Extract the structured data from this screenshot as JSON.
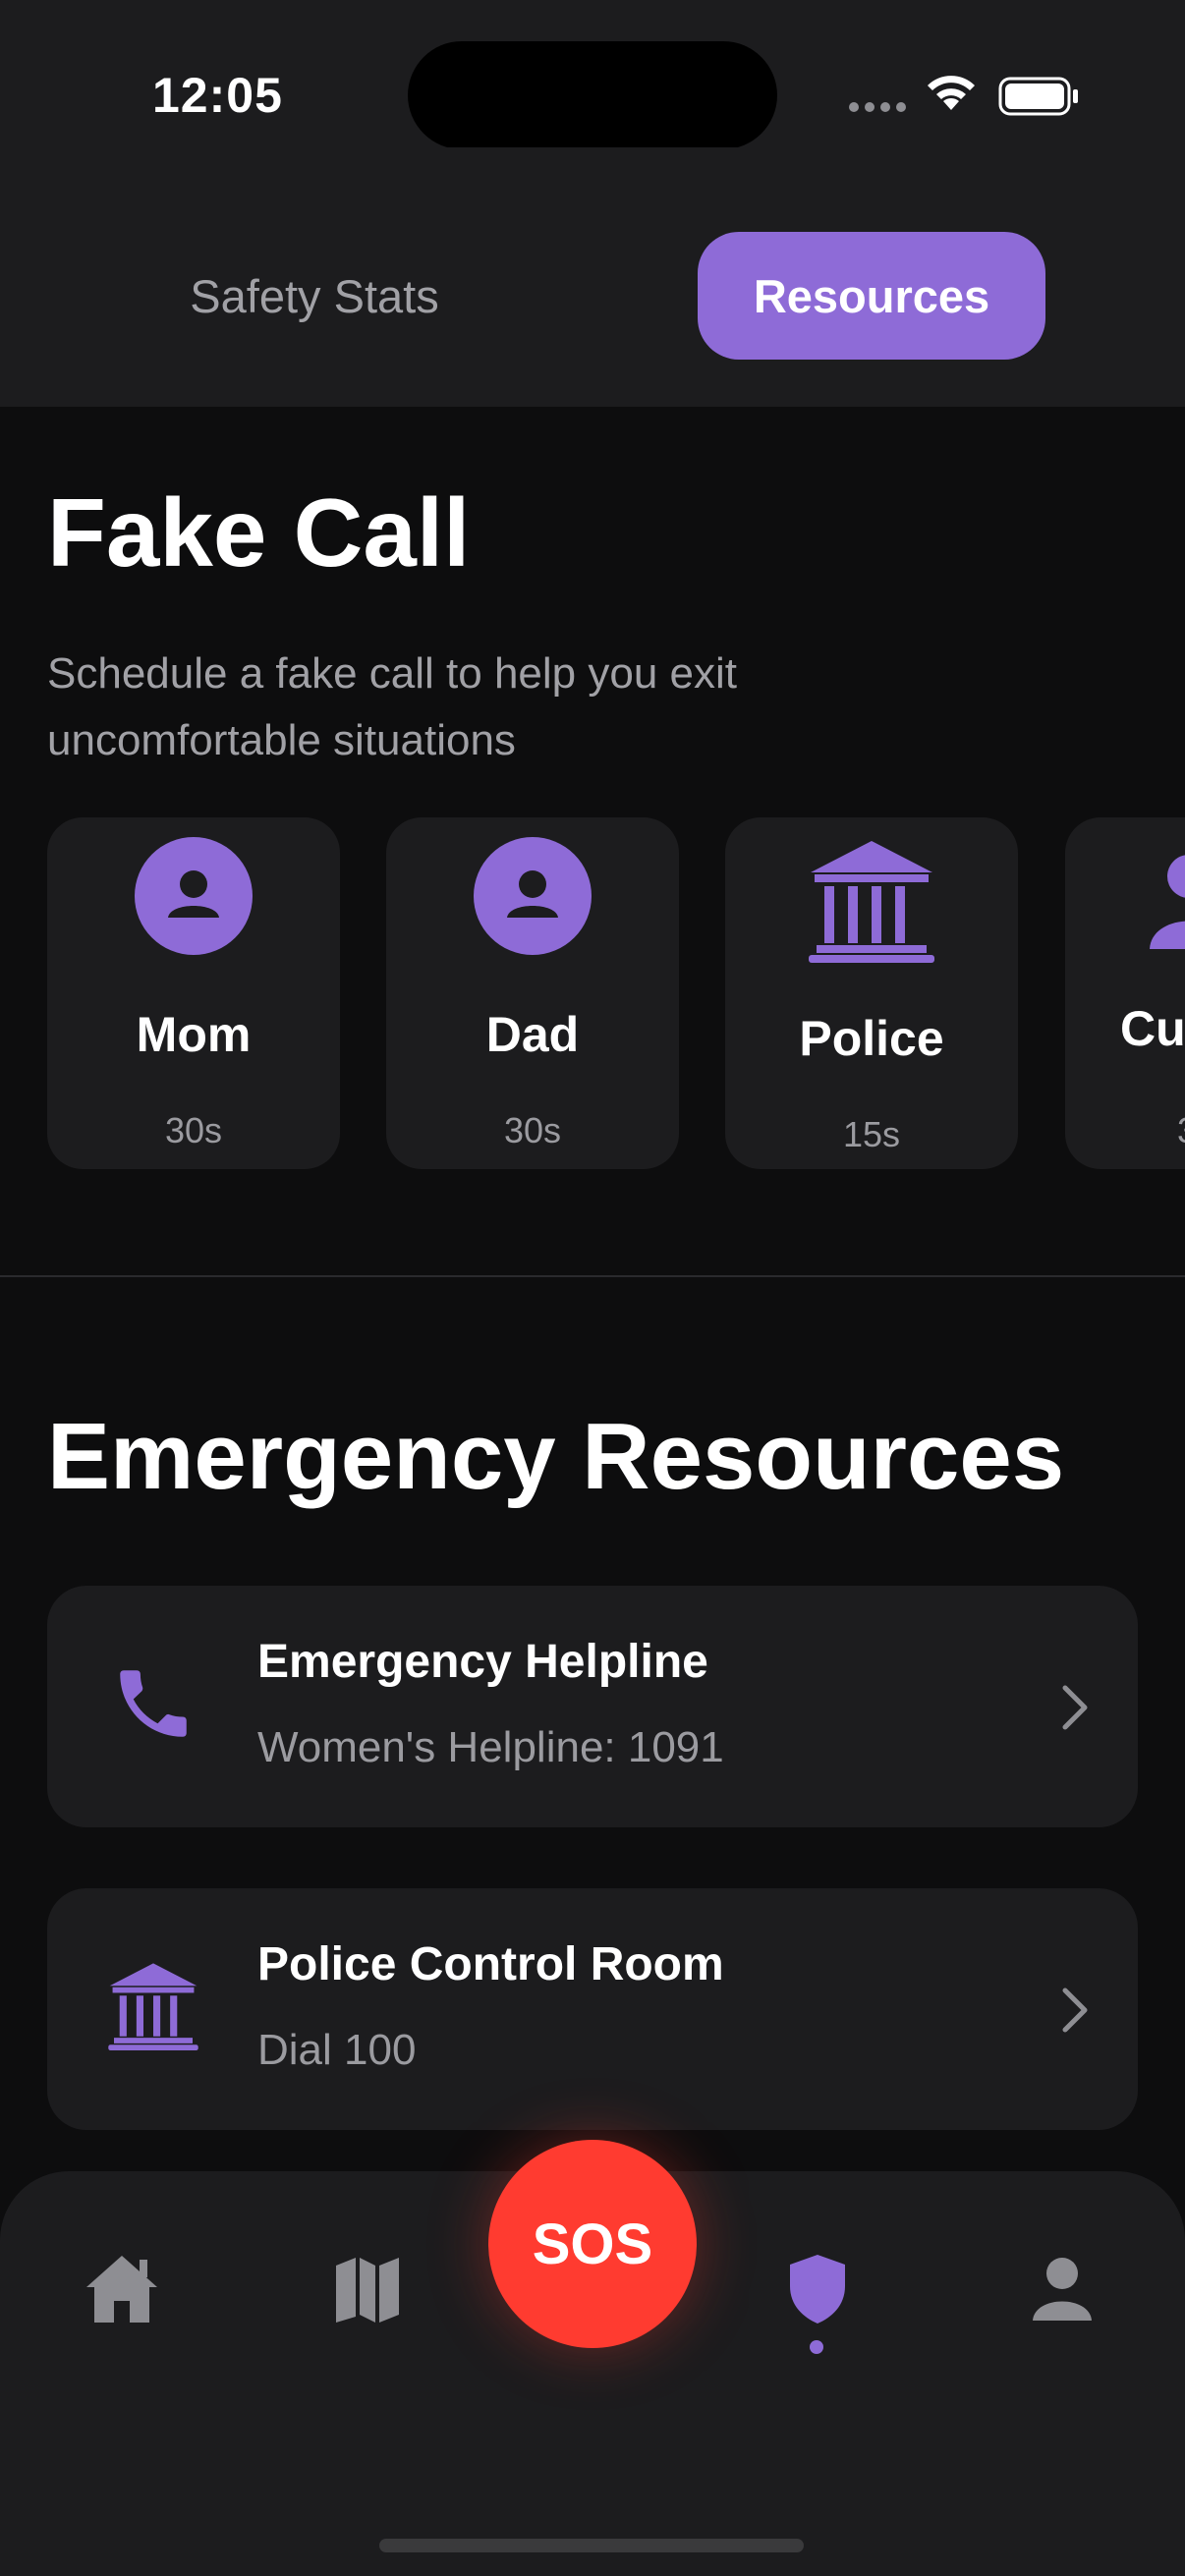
{
  "status_bar": {
    "time": "12:05"
  },
  "tabs": [
    {
      "label": "Safety Stats",
      "active": false
    },
    {
      "label": "Resources",
      "active": true
    }
  ],
  "fake_call": {
    "title": "Fake Call",
    "description": "Schedule a fake call to help you exit uncomfortable situations",
    "callers": [
      {
        "name": "Mom",
        "duration": "30s",
        "icon": "person-icon"
      },
      {
        "name": "Dad",
        "duration": "30s",
        "icon": "person-icon"
      },
      {
        "name": "Police",
        "duration": "15s",
        "icon": "police-building-icon"
      },
      {
        "name": "Cu",
        "duration": "3",
        "icon": "person-icon"
      }
    ]
  },
  "emergency_resources": {
    "title": "Emergency Resources",
    "items": [
      {
        "title": "Emergency Helpline",
        "subtitle": "Women's Helpline: 1091",
        "icon": "phone-icon"
      },
      {
        "title": "Police Control Room",
        "subtitle": "Dial 100",
        "icon": "police-building-icon"
      }
    ]
  },
  "bottom_nav": {
    "items": [
      {
        "name": "home",
        "icon": "home-icon"
      },
      {
        "name": "map",
        "icon": "map-icon"
      },
      {
        "name": "safety",
        "icon": "shield-icon",
        "active": true
      },
      {
        "name": "profile",
        "icon": "person-icon"
      }
    ],
    "sos_label": "SOS"
  },
  "colors": {
    "accent": "#8e6bd7",
    "sos": "#ff3b30",
    "background": "#0d0d0e",
    "card": "#1c1c1e"
  }
}
